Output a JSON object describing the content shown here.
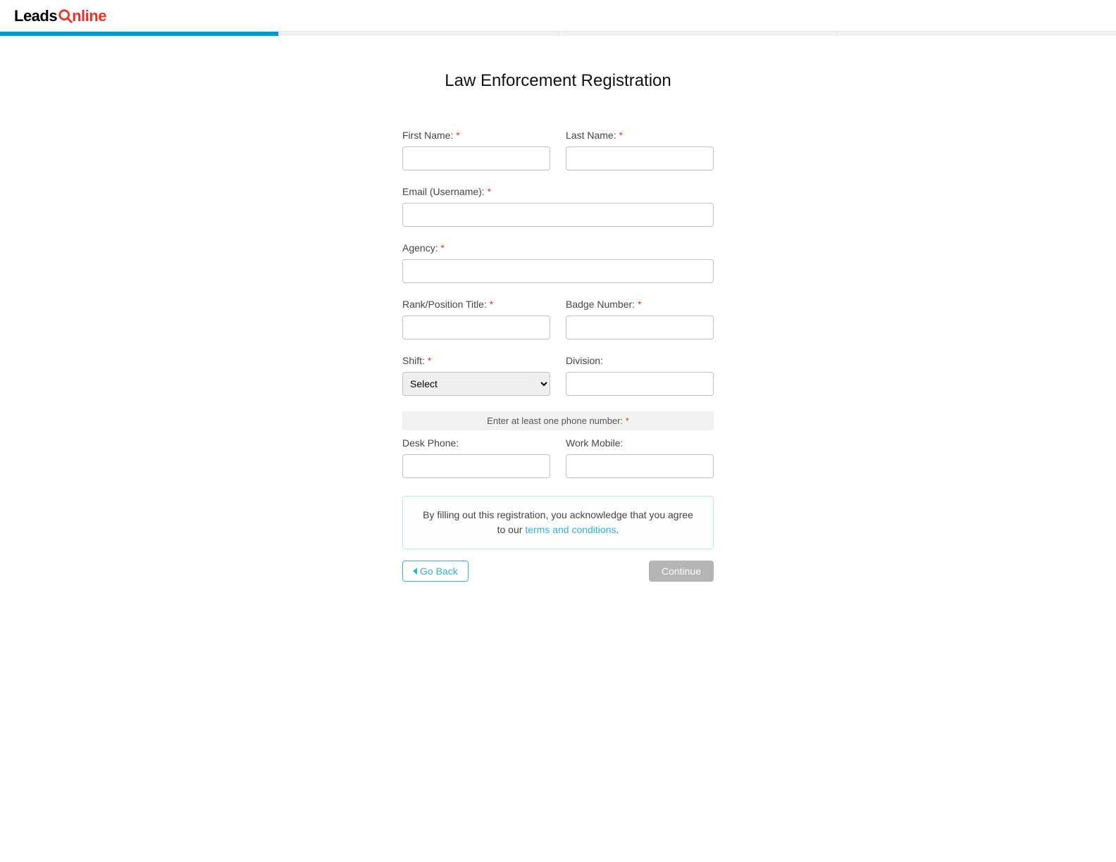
{
  "logo": {
    "leads": "Leads",
    "nline": "nline"
  },
  "page_title": "Law Enforcement Registration",
  "form": {
    "first_name": {
      "label": "First Name:",
      "value": ""
    },
    "last_name": {
      "label": "Last Name:",
      "value": ""
    },
    "email": {
      "label": "Email (Username):",
      "value": ""
    },
    "agency": {
      "label": "Agency:",
      "value": ""
    },
    "rank": {
      "label": "Rank/Position Title:",
      "value": ""
    },
    "badge": {
      "label": "Badge Number:",
      "value": ""
    },
    "shift": {
      "label": "Shift:",
      "selected": "Select"
    },
    "division": {
      "label": "Division:",
      "value": ""
    },
    "phone_note": "Enter at least one phone number:",
    "desk_phone": {
      "label": "Desk Phone:",
      "value": ""
    },
    "work_mobile": {
      "label": "Work Mobile:",
      "value": ""
    }
  },
  "required_marker": "*",
  "terms": {
    "prefix": "By filling out this registration, you acknowledge that you agree to our ",
    "link": "terms and conditions",
    "suffix": "."
  },
  "buttons": {
    "back": "Go Back",
    "continue": "Continue"
  }
}
